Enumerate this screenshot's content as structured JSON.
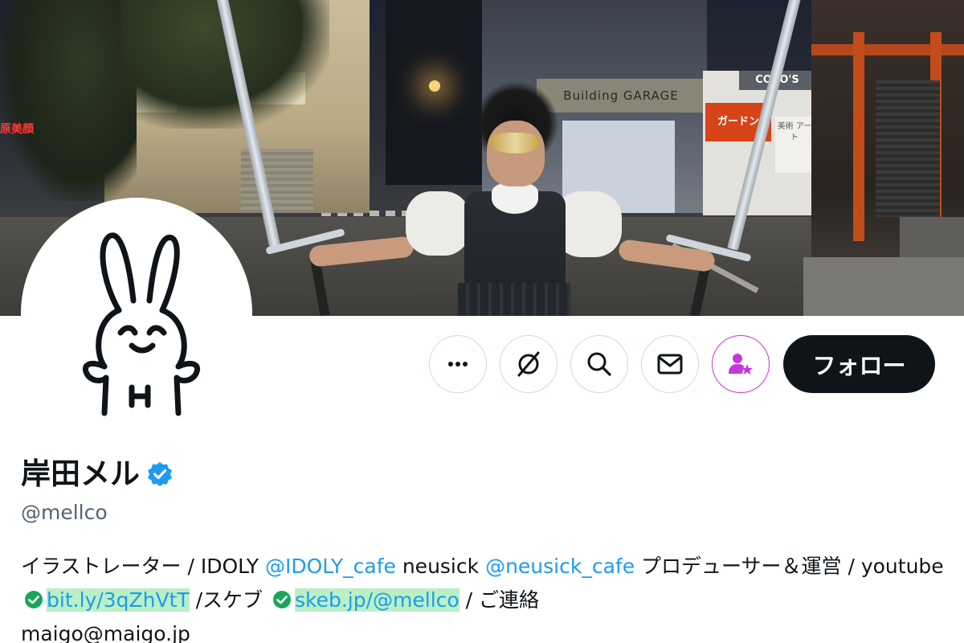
{
  "profile": {
    "display_name": "岸田メル",
    "handle": "@mellco",
    "follow_label": "フォロー",
    "bio": {
      "part1": "イラストレーター / IDOLY ",
      "mention1": "@IDOLY_cafe",
      "part2": " neusick ",
      "mention2": "@neusick_cafe",
      "part3": " プロデューサー＆運営 /  youtube ",
      "link1": "bit.ly/3qZhVtT",
      "part4": " /スケブ ",
      "link2": "skeb.jp/@mellco",
      "part5": " / ご連絡",
      "part6": "maigo@maigo.jp"
    }
  },
  "banner": {
    "signs": {
      "left_red": "原美顔",
      "building": "Building GARAGE",
      "coco": "COCO'S",
      "coco_red": "ガードン",
      "coco_side": "美術 アート"
    }
  },
  "icons": [
    "more-icon",
    "grok-icon",
    "search-icon",
    "mail-icon",
    "subscribe-star-icon",
    "verified-badge-icon",
    "link-check-icon"
  ],
  "colors": {
    "accent": "#1d9bf0",
    "text": "#0f1419",
    "muted": "#536471",
    "link_highlight": "#b9f0c4",
    "subscribe": "#c238d8",
    "follow_bg": "#0f1419"
  }
}
